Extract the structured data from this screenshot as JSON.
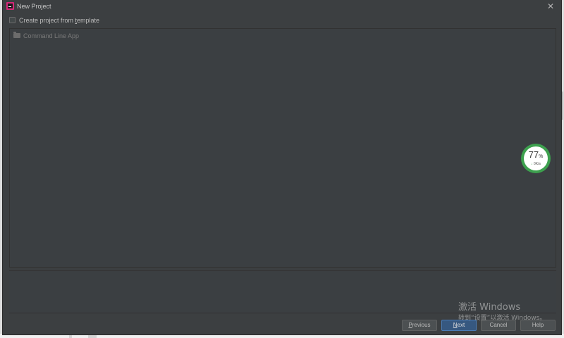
{
  "window": {
    "title": "New Project",
    "close_icon": "close-icon"
  },
  "template_option": {
    "label_prefix": "Create project from ",
    "label_mnemonic": "t",
    "label_suffix": "emplate",
    "checked": false
  },
  "templates": {
    "items": [
      {
        "label": "Command Line App",
        "icon": "folder-icon"
      }
    ]
  },
  "buttons": {
    "previous_mnemonic": "P",
    "previous_rest": "revious",
    "next_mnemonic": "N",
    "next_rest": "ext",
    "cancel": "Cancel",
    "help": "Help"
  },
  "network_widget": {
    "percent": "77",
    "percent_sign": "%",
    "speed": "0K/s"
  },
  "watermark": {
    "title": "激活 Windows",
    "subtitle": "转到“设置”以激活 Windows。"
  }
}
